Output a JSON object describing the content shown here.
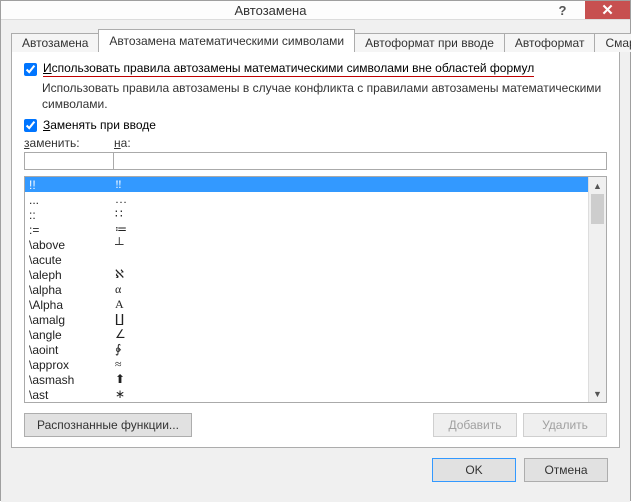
{
  "titlebar": {
    "title": "Автозамена",
    "help": "?",
    "close": "✕"
  },
  "tabs": [
    {
      "label": "Автозамена"
    },
    {
      "label": "Автозамена математическими символами"
    },
    {
      "label": "Автоформат при вводе"
    },
    {
      "label": "Автоформат"
    },
    {
      "label": "Смарт-теги"
    }
  ],
  "panel": {
    "check1_pre": "И",
    "check1_rest": "спользовать правила автозамены математическими символами вне областей формул",
    "desc": "Использовать правила автозамены в случае конфликта с правилами автозамены математическими символами.",
    "check2_pre": "З",
    "check2_rest": "аменять при вводе",
    "col1_pre": "з",
    "col1_rest": "аменить:",
    "col2_pre": "н",
    "col2_rest": "а:"
  },
  "rows": [
    {
      "from": "!!",
      "to": "‼"
    },
    {
      "from": "...",
      "to": "…"
    },
    {
      "from": "::",
      "to": "∷"
    },
    {
      "from": ":=",
      "to": "≔"
    },
    {
      "from": "\\above",
      "to": "┴"
    },
    {
      "from": "\\acute",
      "to": ""
    },
    {
      "from": "\\aleph",
      "to": "ℵ"
    },
    {
      "from": "\\alpha",
      "to": "α"
    },
    {
      "from": "\\Alpha",
      "to": "Α"
    },
    {
      "from": "\\amalg",
      "to": "∐"
    },
    {
      "from": "\\angle",
      "to": "∠"
    },
    {
      "from": "\\aoint",
      "to": "∳"
    },
    {
      "from": "\\approx",
      "to": "≈"
    },
    {
      "from": "\\asmash",
      "to": "⬆"
    },
    {
      "from": "\\ast",
      "to": "∗"
    }
  ],
  "buttons": {
    "recognized": "Распознанные функции...",
    "add": "Добавить",
    "delete": "Удалить",
    "ok": "OK",
    "cancel": "Отмена"
  },
  "scroll": {
    "up": "▲",
    "down": "▼"
  }
}
